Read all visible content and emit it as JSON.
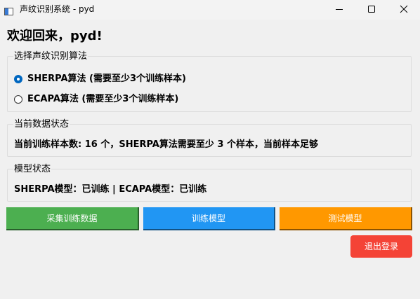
{
  "window": {
    "title": "声纹识别系统 - pyd",
    "controls": {
      "minimize": "minimize-icon",
      "maximize": "maximize-icon",
      "close": "close-icon"
    }
  },
  "welcome": "欢迎回来，pyd!",
  "algorithm_group": {
    "title": "选择声纹识别算法",
    "options": [
      {
        "label": "SHERPA算法 (需要至少3个训练样本)",
        "selected": true
      },
      {
        "label": "ECAPA算法 (需要至少3个训练样本)",
        "selected": false
      }
    ]
  },
  "data_status_group": {
    "title": "当前数据状态",
    "text": "当前训练样本数: 16 个，SHERPA算法需要至少 3 个样本，当前样本足够"
  },
  "model_status_group": {
    "title": "模型状态",
    "text": "SHERPA模型：已训练 | ECAPA模型：已训练"
  },
  "actions": {
    "collect": "采集训练数据",
    "train": "训练模型",
    "test": "测试模型",
    "logout": "退出登录"
  },
  "colors": {
    "collect": "#4caf50",
    "train": "#2196f3",
    "test": "#ff9800",
    "logout": "#f44336",
    "radio_accent": "#0067c0"
  }
}
